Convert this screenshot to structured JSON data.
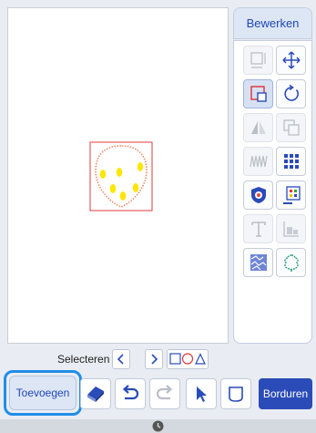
{
  "side": {
    "tab_label": "Bewerken"
  },
  "select": {
    "label": "Selecteren"
  },
  "bottom": {
    "add_label": "Toevoegen",
    "embroider_label": "Borduren"
  },
  "colors": {
    "accent": "#2a4bb8",
    "highlight": "#1f8ee8",
    "design_yellow": "#ffe600",
    "selection_red": "#e03b3b"
  },
  "icons": [
    "size-icon",
    "move-icon",
    "group-icon",
    "rotate-icon",
    "mirror-icon",
    "duplicate-icon",
    "density-icon",
    "array-icon",
    "border-icon",
    "color-sort-icon",
    "text-icon",
    "align-icon",
    "fill-stitch-icon",
    "outline-icon",
    "arrow-left-icon",
    "arrow-right-icon",
    "shapes-select-icon",
    "eraser-icon",
    "undo-icon",
    "redo-icon",
    "pointer-icon",
    "frame-icon",
    "clock-icon"
  ]
}
